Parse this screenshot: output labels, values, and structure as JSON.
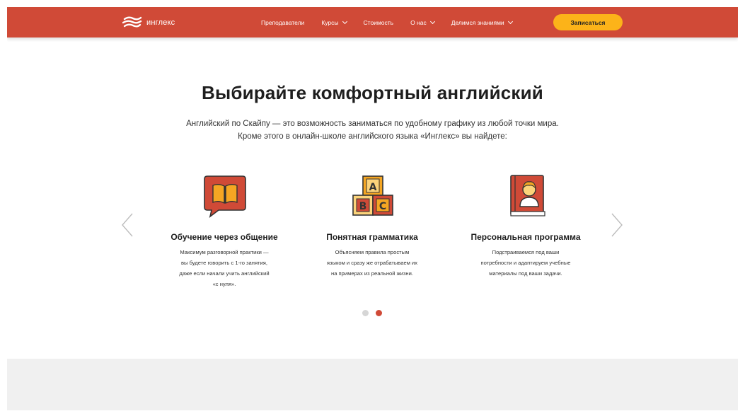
{
  "header": {
    "logo_text": "инглекс",
    "nav": [
      {
        "label": "Преподаватели",
        "dropdown": false
      },
      {
        "label": "Курсы",
        "dropdown": true
      },
      {
        "label": "Стоимость",
        "dropdown": false
      },
      {
        "label": "О нас",
        "dropdown": true
      },
      {
        "label": "Делимся знаниями",
        "dropdown": true
      }
    ],
    "cta_label": "Записаться"
  },
  "hero": {
    "title": "Выбирайте комфортный английский",
    "subtitle_line1": "Английский по Скайпу — это возможность заниматься по удобному графику из любой точки мира.",
    "subtitle_line2": "Кроме этого в онлайн-школе английского языка «Инглекс» вы найдете:"
  },
  "features": [
    {
      "icon": "book-speech-bubble-icon",
      "title": "Обучение через общение",
      "desc_lines": [
        "Максимум разговорной практики —",
        "вы будете говорить с 1-го занятия,",
        "даже если начали учить английский",
        "«с нуля»."
      ]
    },
    {
      "icon": "abc-blocks-icon",
      "title": "Понятная грамматика",
      "desc_lines": [
        "Объясняем правила простым",
        "языком и сразу же отрабатываем их",
        "на примерах из реальной жизни."
      ],
      "blocks": [
        "A",
        "B",
        "C"
      ]
    },
    {
      "icon": "personal-book-icon",
      "title": "Персональная программа",
      "desc_lines": [
        "Подстраиваемся под ваши",
        "потребности и адаптируем учебные",
        "материалы под ваши задачи."
      ]
    }
  ],
  "carousel": {
    "page_count": 2,
    "active_page": 2
  },
  "colors": {
    "brand_red": "#d04a37",
    "cta_yellow": "#fcb319",
    "icon_orange": "#f5a623",
    "dot_inactive": "#d6d6d6",
    "bottom_band": "#f0f0f0"
  }
}
